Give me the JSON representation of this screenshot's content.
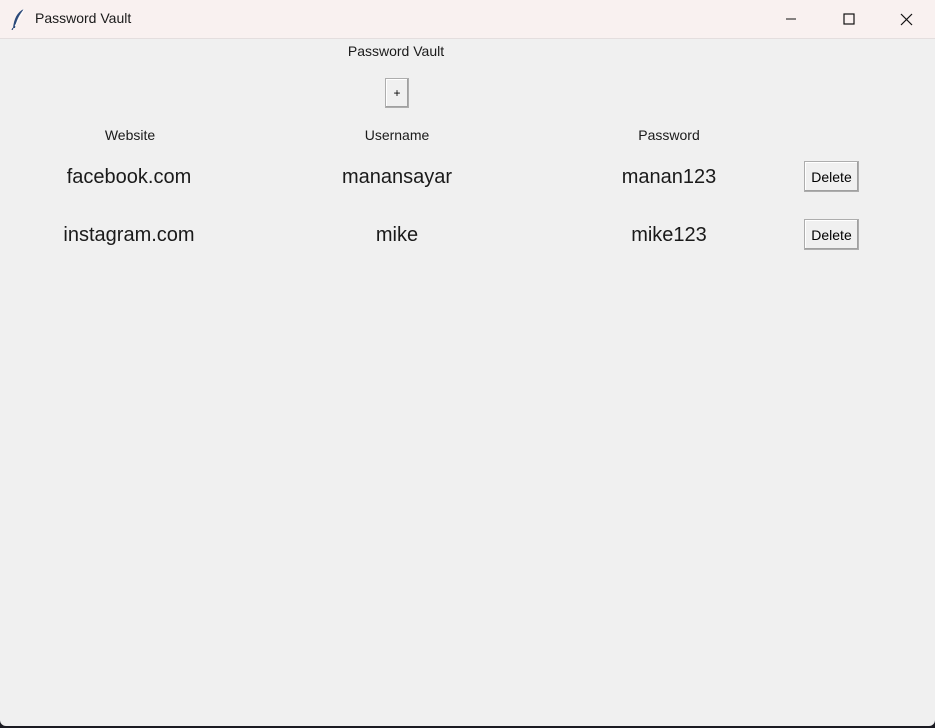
{
  "window": {
    "title": "Password Vault",
    "controls": {
      "minimize": "minimize-icon",
      "maximize": "maximize-icon",
      "close": "close-icon"
    }
  },
  "main": {
    "heading": "Password Vault",
    "add_button_label": "+",
    "columns": {
      "website": "Website",
      "username": "Username",
      "password": "Password"
    },
    "rows": [
      {
        "website": "facebook.com",
        "username": "manansayar",
        "password": "manan123",
        "action": "Delete"
      },
      {
        "website": "instagram.com",
        "username": "mike",
        "password": "mike123",
        "action": "Delete"
      }
    ]
  },
  "colors": {
    "window_bg": "#f0f0f0",
    "titlebar_bg": "#f9f1f0",
    "text": "#1a1a1a"
  }
}
